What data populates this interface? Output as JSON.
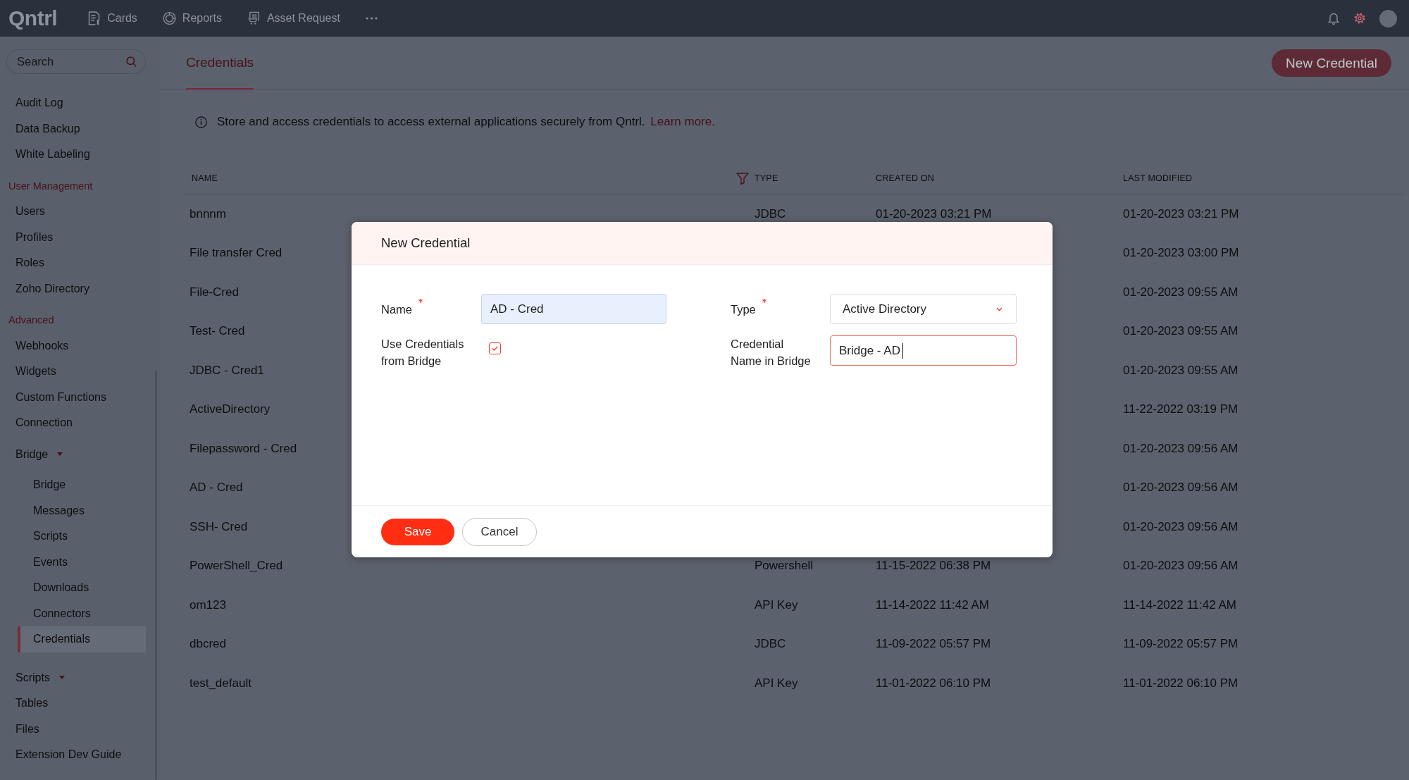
{
  "top_bar": {
    "logo": "Qntrl",
    "nav": [
      {
        "kind": "cards",
        "label": "Cards"
      },
      {
        "kind": "reports",
        "label": "Reports"
      },
      {
        "kind": "requests",
        "label": "Asset Request"
      }
    ]
  },
  "sidebar": {
    "search": {
      "placeholder": "Search"
    },
    "items": [
      {
        "kind": "link",
        "label": "Audit Log",
        "selected": false
      },
      {
        "kind": "link",
        "label": "Data Backup",
        "selected": false
      },
      {
        "kind": "link",
        "label": "White Labeling",
        "selected": false
      },
      {
        "kind": "section",
        "label": "User Management"
      },
      {
        "kind": "link",
        "label": "Users",
        "selected": false
      },
      {
        "kind": "link",
        "label": "Profiles",
        "selected": false
      },
      {
        "kind": "link",
        "label": "Roles",
        "selected": false
      },
      {
        "kind": "link",
        "label": "Zoho Directory",
        "selected": false
      },
      {
        "kind": "section",
        "label": "Advanced"
      },
      {
        "kind": "link",
        "label": "Webhooks",
        "selected": false
      },
      {
        "kind": "link",
        "label": "Widgets",
        "selected": false
      },
      {
        "kind": "link",
        "label": "Custom Functions",
        "selected": false
      },
      {
        "kind": "link",
        "label": "Connection",
        "selected": false
      },
      {
        "kind": "group",
        "label": "Bridge",
        "selected": false,
        "children": [
          {
            "label": "Bridge",
            "selected": false
          },
          {
            "label": "Messages",
            "selected": false
          },
          {
            "label": "Scripts",
            "selected": false
          },
          {
            "label": "Events",
            "selected": false
          },
          {
            "label": "Downloads",
            "selected": false
          },
          {
            "label": "Connectors",
            "selected": false
          },
          {
            "label": "Credentials",
            "selected": true
          }
        ]
      },
      {
        "kind": "group",
        "label": "Scripts",
        "selected": false
      },
      {
        "kind": "link",
        "label": "Tables",
        "selected": false
      },
      {
        "kind": "link",
        "label": "Files",
        "selected": false
      },
      {
        "kind": "link",
        "label": "Extension Dev Guide",
        "selected": false
      }
    ]
  },
  "page_header": {
    "tabs": [
      {
        "label": "Credentials",
        "selected": true
      }
    ],
    "new_button": "New Credential"
  },
  "info": {
    "text": "Store and access credentials to access external applications securely from Qntrl.",
    "link": "Learn more."
  },
  "table": {
    "columns": [
      {
        "label": "NAME",
        "filter": false
      },
      {
        "label": "TYPE",
        "filter": true
      },
      {
        "label": "CREATED ON",
        "filter": false
      },
      {
        "label": "LAST MODIFIED",
        "filter": false
      }
    ],
    "rows": [
      {
        "name": "bnnnm",
        "type": "JDBC",
        "created_on": "01-20-2023 03:21 PM",
        "last_modified": "01-20-2023 03:21 PM"
      },
      {
        "name": "File transfer Cred",
        "last_modified": "01-20-2023 03:00 PM"
      },
      {
        "name": "File-Cred",
        "last_modified": "01-20-2023 09:55 AM"
      },
      {
        "name": "Test- Cred",
        "last_modified": "01-20-2023 09:55 AM"
      },
      {
        "name": "JDBC - Cred1",
        "last_modified": "01-20-2023 09:55 AM"
      },
      {
        "name": "ActiveDirectory",
        "last_modified": "11-22-2022 03:19 PM"
      },
      {
        "name": "Filepassword - Cred",
        "last_modified": "01-20-2023 09:56 AM"
      },
      {
        "name": "AD - Cred",
        "last_modified": "01-20-2023 09:56 AM"
      },
      {
        "name": "SSH- Cred",
        "last_modified": "01-20-2023 09:56 AM"
      },
      {
        "name": "PowerShell_Cred",
        "type": "Powershell",
        "created_on": "11-15-2022 06:38 PM",
        "last_modified": "01-20-2023 09:56 AM"
      },
      {
        "name": "om123",
        "type": "API Key",
        "created_on": "11-14-2022 11:42 AM",
        "last_modified": "11-14-2022 11:42 AM"
      },
      {
        "name": "dbcred",
        "type": "JDBC",
        "created_on": "11-09-2022 05:57 PM",
        "last_modified": "11-09-2022 05:57 PM"
      },
      {
        "name": "test_default",
        "type": "API Key",
        "created_on": "11-01-2022 06:10 PM",
        "last_modified": "11-01-2022 06:10 PM"
      }
    ]
  },
  "dialog": {
    "title": "New Credential",
    "fields": [
      {
        "kind": "text",
        "label": "Name",
        "required": true,
        "value": "AD - Cred",
        "autofilled": true,
        "focused": false
      },
      {
        "kind": "select",
        "label": "Type",
        "required": true,
        "value": "Active Directory"
      },
      {
        "kind": "checkbox",
        "label": "Use Credentials from Bridge",
        "required": false,
        "checked": true
      },
      {
        "kind": "text",
        "label": "Credential Name in Bridge",
        "required": false,
        "value": "Bridge - AD",
        "autofilled": false,
        "focused": true
      }
    ],
    "buttons": [
      {
        "kind": "primary",
        "label": "Save"
      },
      {
        "kind": "secondary",
        "label": "Cancel"
      }
    ]
  }
}
